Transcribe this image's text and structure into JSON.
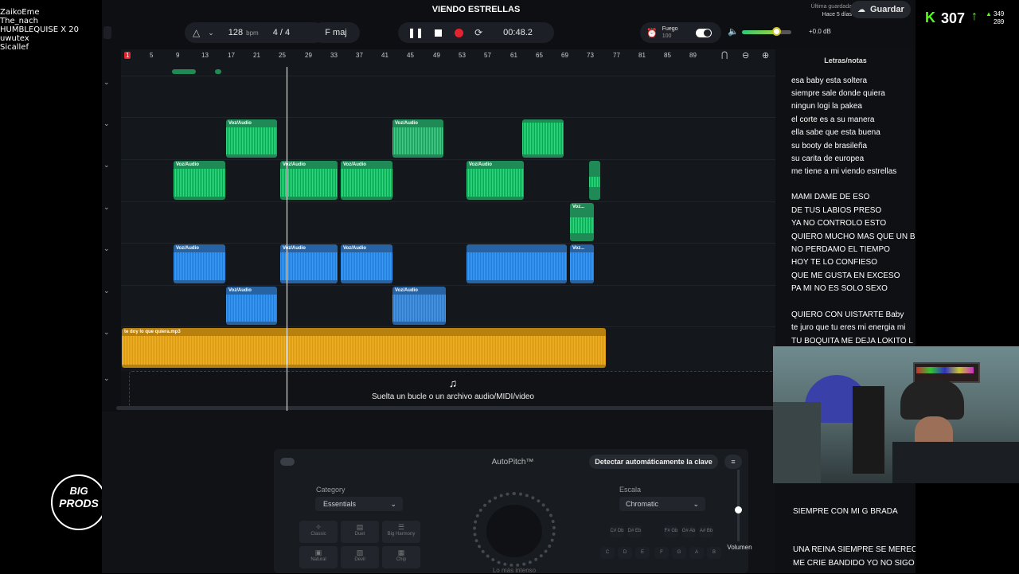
{
  "chat": {
    "lines": [
      "ZaikoEme",
      "The_nach",
      "HUMBLEQUISE X 20",
      "uwutex",
      "Sicallef"
    ]
  },
  "header": {
    "song_title": "VIENDO ESTRELLAS",
    "bpm_value": "128",
    "bpm_unit": "bpm",
    "time_signature": "4 / 4",
    "key": "F maj",
    "time": "00:48.2",
    "fx_name": "Fuego",
    "fx_value": "100",
    "volume_db": "+0.0 dB",
    "save_status": "Última guardada",
    "save_time": "Hace 5 días",
    "save_label": "Guardar"
  },
  "score": {
    "value": "307",
    "up": "349",
    "down": "289"
  },
  "ruler": {
    "ticks": [
      "1",
      "5",
      "9",
      "13",
      "17",
      "21",
      "25",
      "29",
      "33",
      "37",
      "41",
      "45",
      "49",
      "53",
      "57",
      "61",
      "65",
      "69",
      "73",
      "77",
      "81",
      "85",
      "89"
    ]
  },
  "clips": {
    "voz_label": "Voz/Audio",
    "voz_short": "Voz...",
    "mp3_label": "te doy lo que quiera.mp3"
  },
  "dropzone": {
    "text": "Suelta un bucle o un archivo audio/MIDI/video"
  },
  "lyrics": {
    "title": "Letras/notas",
    "lines": [
      "esa baby esta soltera",
      " siempre  sale donde quiera",
      "ningun logi la pakea",
      "el corte es a su manera",
      "ella sabe que esta buena",
      "su booty de brasileña",
      "su carita de europea",
      "me tiene a mi viendo estrellas",
      "MAMI DAME DE ESO",
      " DE TUS LABIOS PRESO",
      " YA NO CONTROLO ESTO",
      "QUIERO MUCHO  MAS QUE UN B",
      "NO PERDAMO EL TIEMPO",
      "HOY TE LO CONFIESO",
      " QUE ME GUSTA EN EXCESO",
      "PA MI  NO  ES SOLO SEXO",
      "QUIERO CON   UISTARTE Baby",
      "  te juro que tu eres mi energia mi",
      "  TU BOQUITA ME DEJA LOKITO L",
      "SIEMPRE CON MI G BRADA",
      "  UNA REINA SIEMPRE SE MEREC",
      "ME CRIE BANDIDO YO NO SIGO L"
    ]
  },
  "autopitch": {
    "title": "AutoPitch™",
    "detect_label": "Detectar automáticamente la clave",
    "category_label": "Category",
    "category_value": "Essentials",
    "scale_label": "Escala",
    "scale_value": "Chromatic",
    "presets": [
      "Classic",
      "Duet",
      "Big Harmony",
      "Natural",
      "Devil",
      "Chip"
    ],
    "keys_top": [
      "C#\nDb",
      "D#\nEb",
      "F#\nGb",
      "G#\nAb",
      "A#\nBb"
    ],
    "keys_bottom": [
      "C",
      "D",
      "E",
      "F",
      "G",
      "A",
      "B"
    ],
    "knob_label": "Lo más intenso",
    "volume_label": "Volumen"
  },
  "overlay": {
    "logo_line1": "BIG",
    "logo_line2": "PRODS"
  }
}
